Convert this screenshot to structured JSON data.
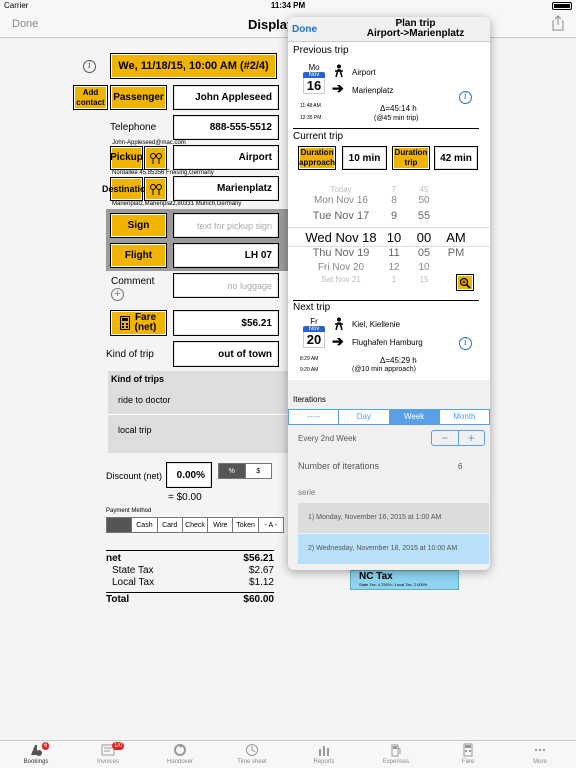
{
  "status": {
    "carrier": "Carrier",
    "time": "11:34 PM"
  },
  "nav": {
    "done": "Done",
    "title": "Display"
  },
  "form": {
    "datetime": "We, 11/18/15, 10:00 AM (#2/4)",
    "add_contact": "Add contact",
    "passenger_label": "Passenger",
    "passenger": "John Appleseed",
    "telephone_label": "Telephone",
    "telephone": "888-555-5512",
    "email": "John-Appleseed@mac.com",
    "pickup_label": "Pickup",
    "pickup": "Airport",
    "pickup_address": "Nordallee 45,85356 Freising,Germany",
    "destination_label": "Destination",
    "destination": "Marienplatz",
    "destination_address": "Marienplatz,Marienplatz,80331 Munich,Germany",
    "sign_label": "Sign",
    "sign_placeholder": "text for pickup sign",
    "flight_label": "Flight",
    "flight": "LH 07",
    "comment_label": "Comment",
    "luggage_placeholder": "no luggage",
    "fare_label": "Fare (net)",
    "fare": "$56.21",
    "kind_label": "Kind of trip",
    "kind": "out of town",
    "kinds_header": "Kind of trips",
    "kinds": [
      "ride to doctor",
      "local trip"
    ],
    "discount_label": "Discount (net)",
    "discount": "0.00%",
    "discount_pct": "%",
    "discount_usd": "$",
    "discount_total": "= $0.00",
    "payment_label": "Payment Method",
    "payment_methods": [
      "",
      "Cash",
      "Card",
      "Check",
      "Wire",
      "Token",
      "- A -"
    ],
    "totals": {
      "net_label": "net",
      "net": "$56.21",
      "state_label": "State Tax",
      "state": "$2.67",
      "local_label": "Local Tax",
      "local": "$1.12",
      "total_label": "Total",
      "total": "$60.00"
    },
    "nc_tax": {
      "title": "NC Tax",
      "detail": "State Tax: 4.750% / Local Tax: 2.000%"
    }
  },
  "popover": {
    "done": "Done",
    "title": "Plan trip",
    "subtitle": "Airport->Marienplatz",
    "previous": {
      "header": "Previous trip",
      "weekday": "Mo",
      "month": "Nov",
      "day": "16",
      "time_top": "11:48 AM",
      "time_bottom": "12:35 PM",
      "from": "Airport",
      "to": "Marienplatz",
      "delta": "Δ=45:14 h",
      "note": "(@45 min trip)"
    },
    "current": {
      "header": "Current trip",
      "approach_label": "Duration approach",
      "approach": "10 min",
      "trip_label": "Duration trip",
      "trip": "42 min",
      "picker_rows": [
        {
          "d": "Today",
          "h": "7",
          "m": "45",
          "ap": ""
        },
        {
          "d": "Mon Nov 16",
          "h": "8",
          "m": "50",
          "ap": ""
        },
        {
          "d": "Tue Nov 17",
          "h": "9",
          "m": "55",
          "ap": ""
        },
        {
          "d": "Wed Nov 18",
          "h": "10",
          "m": "00",
          "ap": "AM"
        },
        {
          "d": "Thu Nov 19",
          "h": "11",
          "m": "05",
          "ap": "PM"
        },
        {
          "d": "Fri Nov 20",
          "h": "12",
          "m": "10",
          "ap": ""
        },
        {
          "d": "Sat Nov 21",
          "h": "1",
          "m": "15",
          "ap": ""
        }
      ]
    },
    "next": {
      "header": "Next trip",
      "weekday": "Fr",
      "month": "Nov",
      "day": "20",
      "time_top": "8:29 AM",
      "time_bottom": "9:20 AM",
      "from": "Kiel, Kiellenie",
      "to": "Flughafen Hamburg",
      "delta": "Δ=45:29 h",
      "note": "(@10 min approach)"
    },
    "iterations": {
      "header": "Iterations",
      "tabs": [
        "-----",
        "Day",
        "Week",
        "Month"
      ],
      "every": "Every 2nd Week",
      "minus": "−",
      "plus": "+",
      "count_label": "Number of iterations",
      "count": "6"
    },
    "serie": {
      "header": "serie",
      "items": [
        "1) Monday, November 16, 2015 at 1:00 AM",
        "2) Wednesday, November 18, 2015 at 10:00 AM"
      ]
    }
  },
  "tabbar": [
    {
      "label": "Bookings",
      "badge": "6"
    },
    {
      "label": "Invoices",
      "badge": "1/0"
    },
    {
      "label": "Handover",
      "badge": ""
    },
    {
      "label": "Time sheet",
      "badge": ""
    },
    {
      "label": "Reports",
      "badge": ""
    },
    {
      "label": "Expenses",
      "badge": ""
    },
    {
      "label": "Fare",
      "badge": ""
    },
    {
      "label": "More",
      "badge": ""
    }
  ]
}
